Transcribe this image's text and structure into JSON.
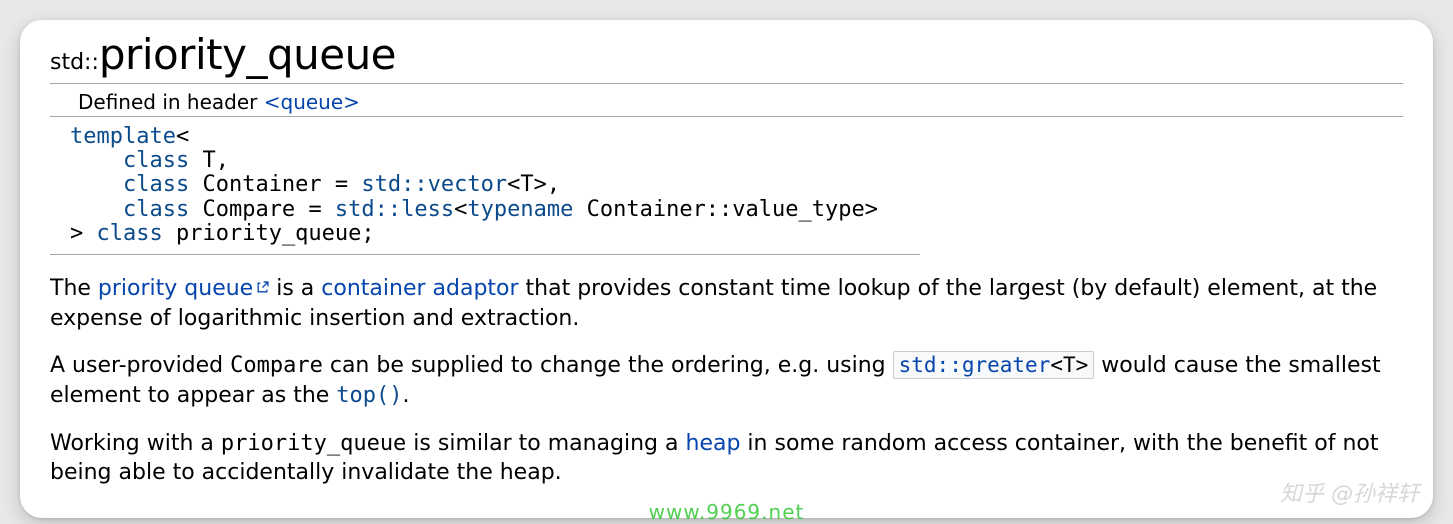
{
  "title": {
    "ns": "std::",
    "name": "priority_queue"
  },
  "defined": {
    "prefix": "Defined in header ",
    "header": "<queue>"
  },
  "decl": {
    "l1a": "template",
    "l1b": "<",
    "l2a": "    class",
    "l2b": " T,",
    "l3a": "    class",
    "l3b": " Container ",
    "l3c": "=",
    "l3d": " std::vector",
    "l3e": "<",
    "l3f": "T",
    "l3g": ">",
    "l3h": ",",
    "l4a": "    class",
    "l4b": " Compare ",
    "l4c": "=",
    "l4d": " std::less",
    "l4e": "<",
    "l4f": "typename",
    "l4g": " Container::value_type",
    "l4h": ">",
    "l5a": ">",
    "l5b": " class",
    "l5c": " priority_queue",
    "l5d": ";"
  },
  "p1": {
    "t1": "The ",
    "link1": "priority queue",
    "t2": " is a ",
    "link2": "container adaptor",
    "t3": " that provides constant time lookup of the largest (by default) element, at the expense of logarithmic insertion and extraction."
  },
  "p2": {
    "t1": "A user-provided ",
    "compare": "Compare",
    "t2": " can be supplied to change the ordering, e.g. using ",
    "code_a": "std::greater",
    "code_b": "<T>",
    "t3": " would cause the smallest element to appear as the ",
    "top": "top()",
    "t4": "."
  },
  "p3": {
    "t1": "Working with a ",
    "pq": "priority_queue",
    "t2": " is similar to managing a ",
    "heap": "heap",
    "t3": " in some random access container, with the benefit of not being able to accidentally invalidate the heap."
  },
  "watermarks": {
    "w1": "www.9969.net",
    "w2": "知乎 @孙祥轩"
  }
}
